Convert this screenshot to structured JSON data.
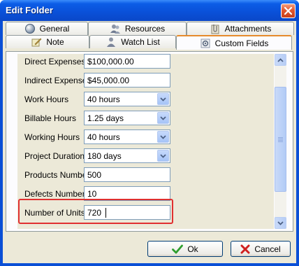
{
  "window": {
    "title": "Edit Folder"
  },
  "tabs": {
    "row1": [
      {
        "label": "General",
        "icon": "globe-icon"
      },
      {
        "label": "Resources",
        "icon": "resources-icon"
      },
      {
        "label": "Attachments",
        "icon": "paperclip-icon"
      }
    ],
    "row2": [
      {
        "label": "Note",
        "icon": "note-icon"
      },
      {
        "label": "Watch List",
        "icon": "watch-list-icon"
      },
      {
        "label": "Custom Fields",
        "icon": "gear-icon",
        "active": true
      }
    ]
  },
  "fields": [
    {
      "label": "Direct Expenses",
      "value": "$100,000.00",
      "type": "text"
    },
    {
      "label": "Indirect Expenses",
      "value": "$45,000.00",
      "type": "text"
    },
    {
      "label": "Work Hours",
      "value": "40 hours",
      "type": "dropdown"
    },
    {
      "label": "Billable Hours",
      "value": "1.25 days",
      "type": "dropdown"
    },
    {
      "label": "Working Hours",
      "value": "40 hours",
      "type": "dropdown"
    },
    {
      "label": "Project Duration",
      "value": "180 days",
      "type": "dropdown"
    },
    {
      "label": "Products Number",
      "value": "500",
      "type": "text"
    },
    {
      "label": "Defects Number",
      "value": "10",
      "type": "text"
    },
    {
      "label": "Number of Units",
      "value": "720",
      "type": "text",
      "focused": true
    }
  ],
  "buttons": {
    "ok": "Ok",
    "cancel": "Cancel"
  },
  "colors": {
    "title_bar": "#0a50d8",
    "highlight": "#e03030",
    "active_tab_accent": "#e68b2c",
    "ok_check": "#2e9e2e",
    "cancel_x": "#d02020"
  }
}
